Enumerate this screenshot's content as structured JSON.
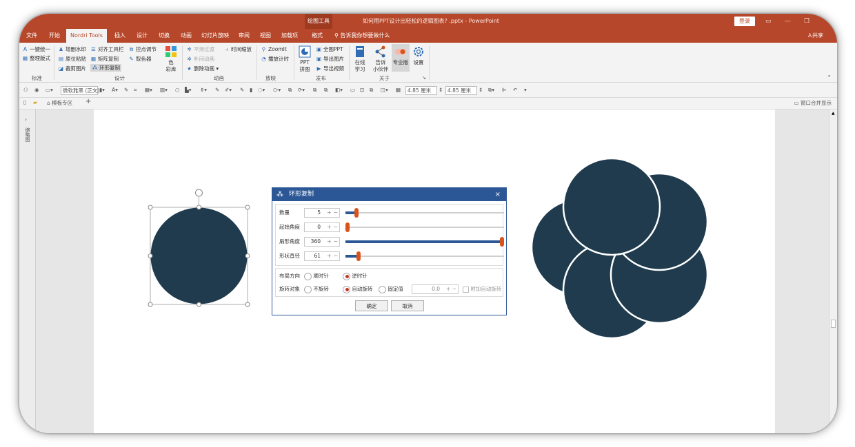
{
  "window": {
    "context_tool": "绘图工具",
    "doc_title": "如何用PPT设计出轻松的逻辑图表? .pptx - PowerPoint",
    "login": "登录"
  },
  "menu": {
    "tabs": [
      "文件",
      "开始",
      "Nordri Tools",
      "插入",
      "设计",
      "切换",
      "动画",
      "幻灯片放映",
      "审阅",
      "视图",
      "加载项",
      "格式"
    ],
    "active_tab": "Nordri Tools",
    "tell_me": "告诉我你想要做什么",
    "share": "共享"
  },
  "ribbon": {
    "standard": {
      "items": [
        "一键统一",
        "整理版式"
      ],
      "group": "标准"
    },
    "design": {
      "items": [
        "增删水印",
        "对齐工具栏",
        "控点调节",
        "原位粘贴",
        "矩阵复制",
        "取色器",
        "裁剪图片",
        "环形复制"
      ],
      "group": "设计"
    },
    "color": {
      "top": "色",
      "bottom": "彩库"
    },
    "animation": {
      "items": [
        "平滑过渡",
        "时间缩放",
        "补间动画",
        "删除动画"
      ],
      "group": "动画"
    },
    "playback": {
      "items": [
        "ZoomIt",
        "播放计时"
      ],
      "group": "放映"
    },
    "publish": {
      "ppt_top": "PPT",
      "ppt_bottom": "拼图",
      "items": [
        "全图PPT",
        "导出图片",
        "导出视频"
      ],
      "group": "发布"
    },
    "about": {
      "online_top": "在线",
      "online_bottom": "学习",
      "tell_top": "告诉",
      "tell_bottom": "小伙伴",
      "pro": "专业版",
      "settings": "设置",
      "group": "关于"
    }
  },
  "format_toolbar": {
    "font": "微软雅黑 (正文)",
    "width": "4.85 厘米",
    "height": "4.85 厘米"
  },
  "tabstrip": {
    "template_zone": "模板专区",
    "merge_windows": "窗口合并显示"
  },
  "left_panel": {
    "label": "缩略图"
  },
  "dialog": {
    "title": "环形复制",
    "rows": [
      {
        "label": "数量",
        "value": "5",
        "fraction": 0.06
      },
      {
        "label": "起始角度",
        "value": "0",
        "fraction": 0.0
      },
      {
        "label": "扇形角度",
        "value": "360",
        "fraction": 1.0
      },
      {
        "label": "形状直径",
        "value": "61",
        "fraction": 0.07
      }
    ],
    "layout_direction": {
      "label": "布局方向",
      "options": [
        "顺时针",
        "逆时针"
      ],
      "selected": "逆时针"
    },
    "rotation": {
      "label": "旋转对象",
      "options": [
        "不旋转",
        "自动旋转",
        "固定值"
      ],
      "selected": "自动旋转",
      "fixed_value": "0.0",
      "extra": "附加自动旋转"
    },
    "ok": "确定",
    "cancel": "取消"
  },
  "colors": {
    "accent": "#b7472a",
    "circle_fill": "#1f3b4d",
    "dialog_blue": "#2b5797",
    "slider_thumb": "#d9531e"
  }
}
